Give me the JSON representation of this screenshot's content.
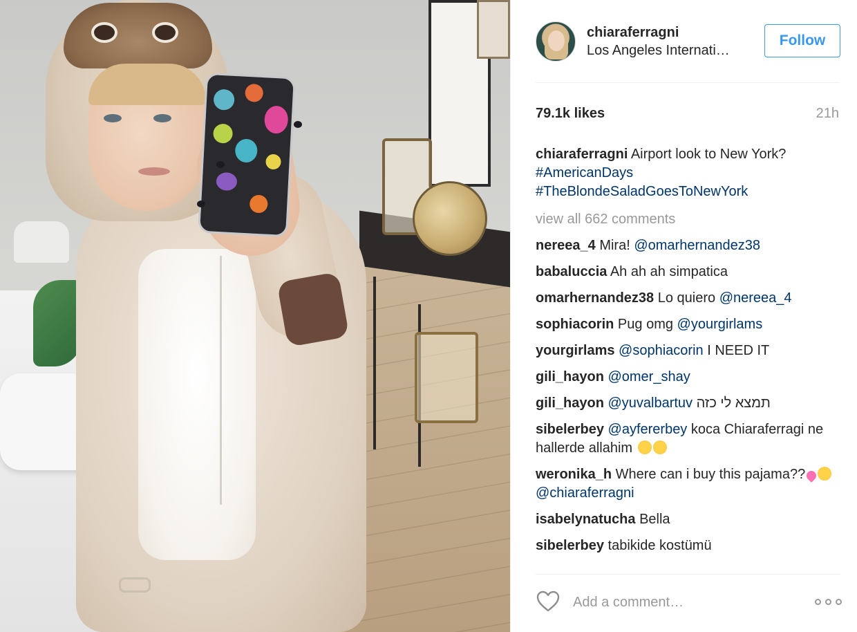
{
  "post": {
    "image_alt": "Woman in pug onesie taking a mirror selfie"
  },
  "header": {
    "username": "chiaraferragni",
    "location": "Los Angeles Internati…",
    "follow_label": "Follow"
  },
  "stats": {
    "likes": "79.1k likes",
    "time": "21h"
  },
  "caption": {
    "user": "chiaraferragni",
    "text": "Airport look to New York?",
    "tag1": "#AmericanDays",
    "tag2": "#TheBlondeSaladGoesToNewYork"
  },
  "view_all": "view all 662 comments",
  "comments": [
    {
      "user": "nereea_4",
      "text": "Mira!",
      "mention": "@omarhernandez38"
    },
    {
      "user": "babaluccia",
      "text": "Ah ah ah simpatica"
    },
    {
      "user": "omarhernandez38",
      "text": "Lo quiero",
      "mention": "@nereea_4"
    },
    {
      "user": "sophiacorin",
      "text": "Pug omg",
      "mention": "@yourgirlams"
    },
    {
      "user": "yourgirlams",
      "mention": "@sophiacorin",
      "text_after": "I NEED IT"
    },
    {
      "user": "gili_hayon",
      "mention": "@omer_shay"
    },
    {
      "user": "gili_hayon",
      "mention": "@yuvalbartuv",
      "text_after": "תמצא לי כזה"
    },
    {
      "user": "sibelerbey",
      "mention": "@ayfererbey",
      "text_after": "koca Chiaraferragi ne hallerde allahim"
    },
    {
      "user": "weronika_h",
      "text": "Where can i buy this pajama??",
      "mention": "@chiaraferragni"
    },
    {
      "user": "isabelynatucha",
      "text": "Bella"
    },
    {
      "user": "sibelerbey",
      "text": "tabikide kostümü"
    }
  ],
  "footer": {
    "comment_placeholder": "Add a comment…"
  },
  "colors": {
    "link": "#003569",
    "follow_blue": "#3897f0",
    "muted": "#999999"
  },
  "icons": {
    "like": "heart-outline-icon",
    "more": "more-options-icon"
  }
}
